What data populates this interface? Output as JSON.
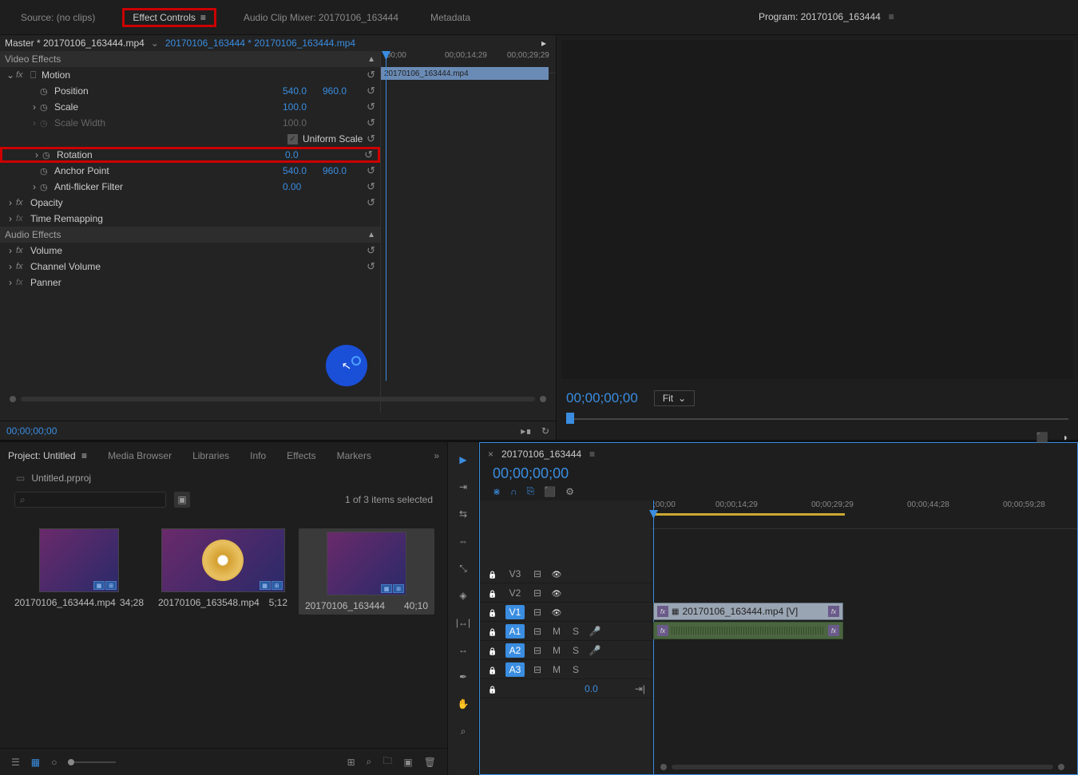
{
  "topTabs": {
    "source": "Source: (no clips)",
    "effectControls": "Effect Controls",
    "audioMixer": "Audio Clip Mixer: 20170106_163444",
    "metadata": "Metadata"
  },
  "program": {
    "title": "Program: 20170106_163444",
    "timecode": "00;00;00;00",
    "fit": "Fit"
  },
  "effectControls": {
    "master": "Master * 20170106_163444.mp4",
    "active": "20170106_163444 * 20170106_163444.mp4",
    "videoEffects": "Video Effects",
    "motion": "Motion",
    "position": "Position",
    "positionX": "540.0",
    "positionY": "960.0",
    "scale": "Scale",
    "scaleVal": "100.0",
    "scaleWidth": "Scale Width",
    "scaleWidthVal": "100.0",
    "uniformScale": "Uniform Scale",
    "rotation": "Rotation",
    "rotationVal": "0.0",
    "anchorPoint": "Anchor Point",
    "anchorX": "540.0",
    "anchorY": "960.0",
    "antiFlicker": "Anti-flicker Filter",
    "antiFlickerVal": "0.00",
    "opacity": "Opacity",
    "timeRemap": "Time Remapping",
    "audioEffects": "Audio Effects",
    "volume": "Volume",
    "channelVolume": "Channel Volume",
    "panner": "Panner",
    "timecode": "00;00;00;00",
    "clipName": "20170106_163444.mp4",
    "ruler": {
      "t0": ";00;00",
      "t1": "00;00;14;29",
      "t2": "00;00;29;29"
    }
  },
  "project": {
    "tabs": {
      "project": "Project: Untitled",
      "mediaBrowser": "Media Browser",
      "libraries": "Libraries",
      "info": "Info",
      "effects": "Effects",
      "markers": "Markers"
    },
    "filename": "Untitled.prproj",
    "selectedText": "1 of 3 items selected",
    "bins": [
      {
        "name": "20170106_163444.mp4",
        "dur": "34;28",
        "selected": false,
        "wide": false,
        "disc": false
      },
      {
        "name": "20170106_163548.mp4",
        "dur": "5;12",
        "selected": false,
        "wide": true,
        "disc": true
      },
      {
        "name": "20170106_163444",
        "dur": "40;10",
        "selected": true,
        "wide": false,
        "disc": false
      }
    ]
  },
  "timeline": {
    "name": "20170106_163444",
    "timecode": "00;00;00;00",
    "speed": "0.0",
    "ruler": {
      "t0": ";00;00",
      "t1": "00;00;14;29",
      "t2": "00;00;29;29",
      "t3": "00;00;44;28",
      "t4": "00;00;59;28"
    },
    "tracks": {
      "v3": "V3",
      "v2": "V2",
      "v1": "V1",
      "a1": "A1",
      "a2": "A2",
      "a3": "A3"
    },
    "mute": "M",
    "solo": "S",
    "clipV1": "20170106_163444.mp4 [V]"
  }
}
